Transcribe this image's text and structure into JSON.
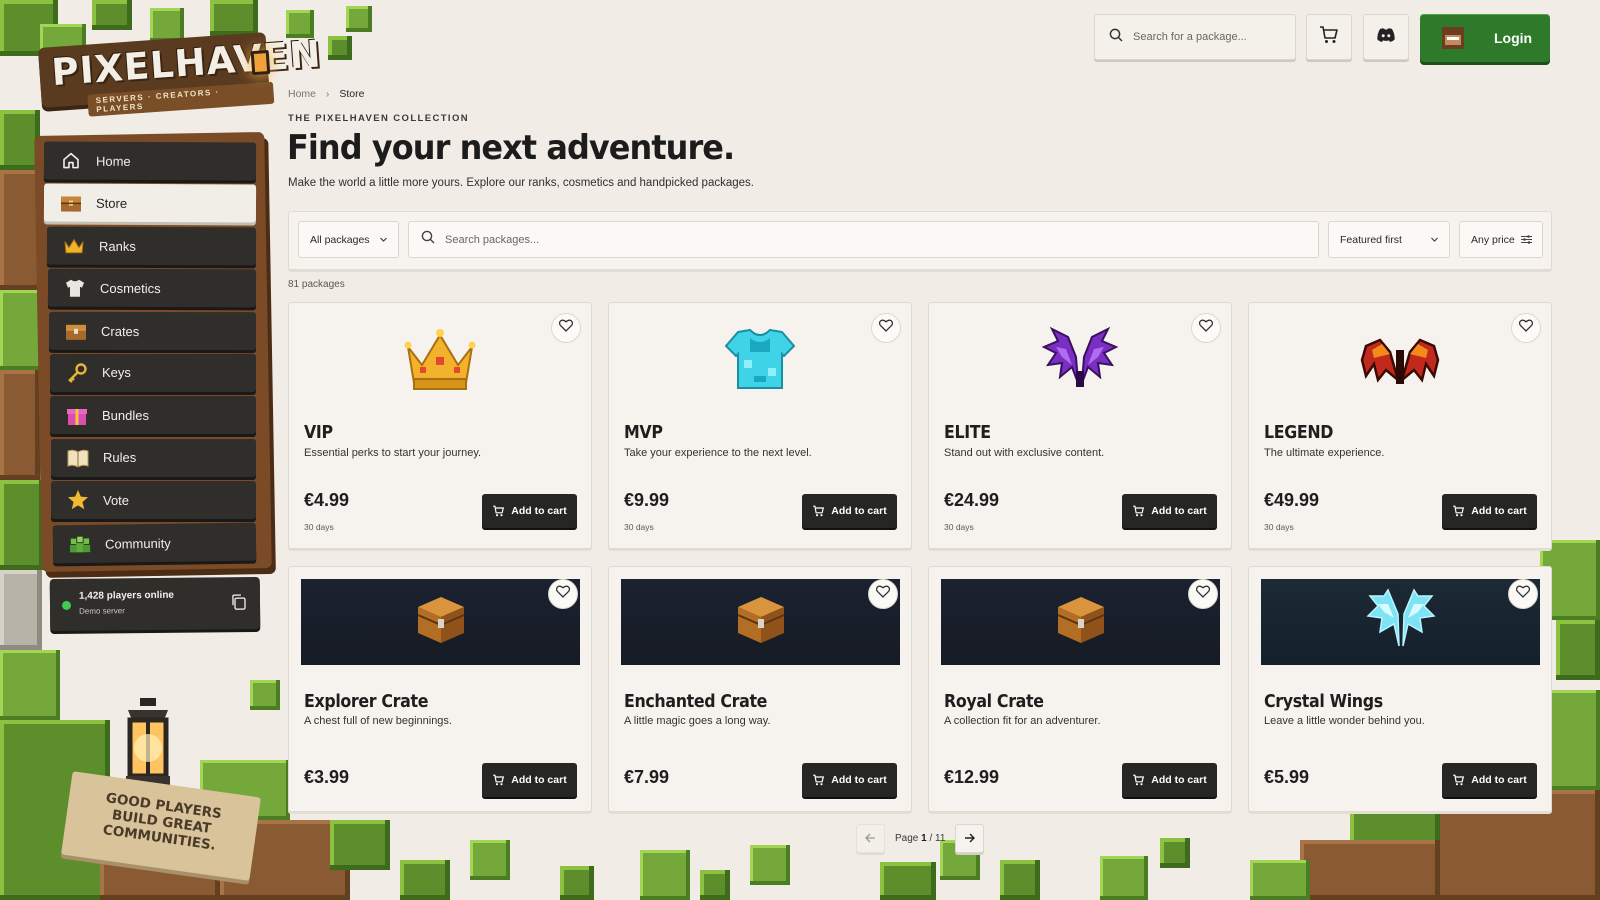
{
  "brand": {
    "name": "PIXELHAVEN",
    "tagline": "SERVERS · CREATORS · PLAYERS"
  },
  "header": {
    "search_placeholder": "Search for a package...",
    "login_label": "Login",
    "icons": [
      "search-icon",
      "cart-icon",
      "discord-icon",
      "avatar"
    ],
    "accent_green": "#2f7a2a"
  },
  "sidebar": {
    "items": [
      {
        "label": "Home",
        "icon": "home-icon",
        "active": false
      },
      {
        "label": "Store",
        "icon": "chest-icon",
        "active": true
      },
      {
        "label": "Ranks",
        "icon": "crown-icon",
        "active": false
      },
      {
        "label": "Cosmetics",
        "icon": "shirt-icon",
        "active": false
      },
      {
        "label": "Crates",
        "icon": "crate-icon",
        "active": false
      },
      {
        "label": "Keys",
        "icon": "key-icon",
        "active": false
      },
      {
        "label": "Bundles",
        "icon": "gift-icon",
        "active": false
      },
      {
        "label": "Rules",
        "icon": "book-icon",
        "active": false
      },
      {
        "label": "Vote",
        "icon": "star-icon",
        "active": false
      },
      {
        "label": "Community",
        "icon": "people-icon",
        "active": false
      }
    ],
    "status": {
      "players": "1,428 players online",
      "server": "Demo server",
      "status_color": "#3fcb4d"
    },
    "sign": "GOOD PLAYERS\nBUILD GREAT\nCOMMUNITIES."
  },
  "main": {
    "breadcrumb": {
      "home": "Home",
      "current": "Store"
    },
    "eyebrow": "THE PIXELHAVEN COLLECTION",
    "title": "Find your next adventure.",
    "subtitle": "Make the world a little more yours. Explore our ranks, cosmetics and handpicked packages.",
    "filters": {
      "category": "All packages",
      "search_placeholder": "Search packages...",
      "sort": "Featured first",
      "price": "Any price"
    },
    "count": "81 packages",
    "add_to_cart_label": "Add to cart",
    "packages": [
      {
        "name": "VIP",
        "desc": "Essential perks to start your journey.",
        "price": "€4.99",
        "duration": "30 days",
        "art": "crown-icon"
      },
      {
        "name": "MVP",
        "desc": "Take your experience to the next level.",
        "price": "€9.99",
        "duration": "30 days",
        "art": "diamond-chestplate-icon"
      },
      {
        "name": "ELITE",
        "desc": "Stand out with exclusive content.",
        "price": "€24.99",
        "duration": "30 days",
        "art": "purple-wings-icon"
      },
      {
        "name": "LEGEND",
        "desc": "The ultimate experience.",
        "price": "€49.99",
        "duration": "30 days",
        "art": "fire-wings-icon"
      },
      {
        "name": "Explorer Crate",
        "desc": "A chest full of new beginnings.",
        "price": "€3.99",
        "art": "chest-icon"
      },
      {
        "name": "Enchanted Crate",
        "desc": "A little magic goes a long way.",
        "price": "€7.99",
        "art": "chest-icon"
      },
      {
        "name": "Royal Crate",
        "desc": "A collection fit for an adventurer.",
        "price": "€12.99",
        "art": "chest-icon"
      },
      {
        "name": "Crystal Wings",
        "desc": "Leave a little wonder behind you.",
        "price": "€5.99",
        "art": "crystal-wings-icon"
      }
    ],
    "pagination": {
      "prefix": "Page",
      "current": "1",
      "total": "/ 11"
    }
  }
}
